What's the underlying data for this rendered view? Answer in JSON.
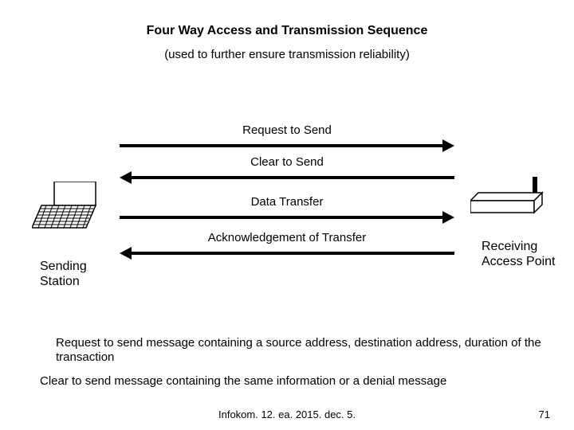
{
  "title": "Four Way Access and Transmission Sequence",
  "subtitle": "(used to further ensure transmission reliability)",
  "arrows": {
    "rts": "Request to Send",
    "cts": "Clear to Send",
    "data": "Data Transfer",
    "ack": "Acknowledgement of Transfer"
  },
  "sender_label_l1": "Sending",
  "sender_label_l2": "Station",
  "receiver_label_l1": "Receiving",
  "receiver_label_l2": "Access Point",
  "bullet1": "Request to send message containing a source address, destination address, duration of the transaction",
  "bullet2": "Clear to send message containing the same information or a denial message",
  "footer_center": "Infokom. 12. ea. 2015. dec.  5.",
  "footer_page": "71"
}
